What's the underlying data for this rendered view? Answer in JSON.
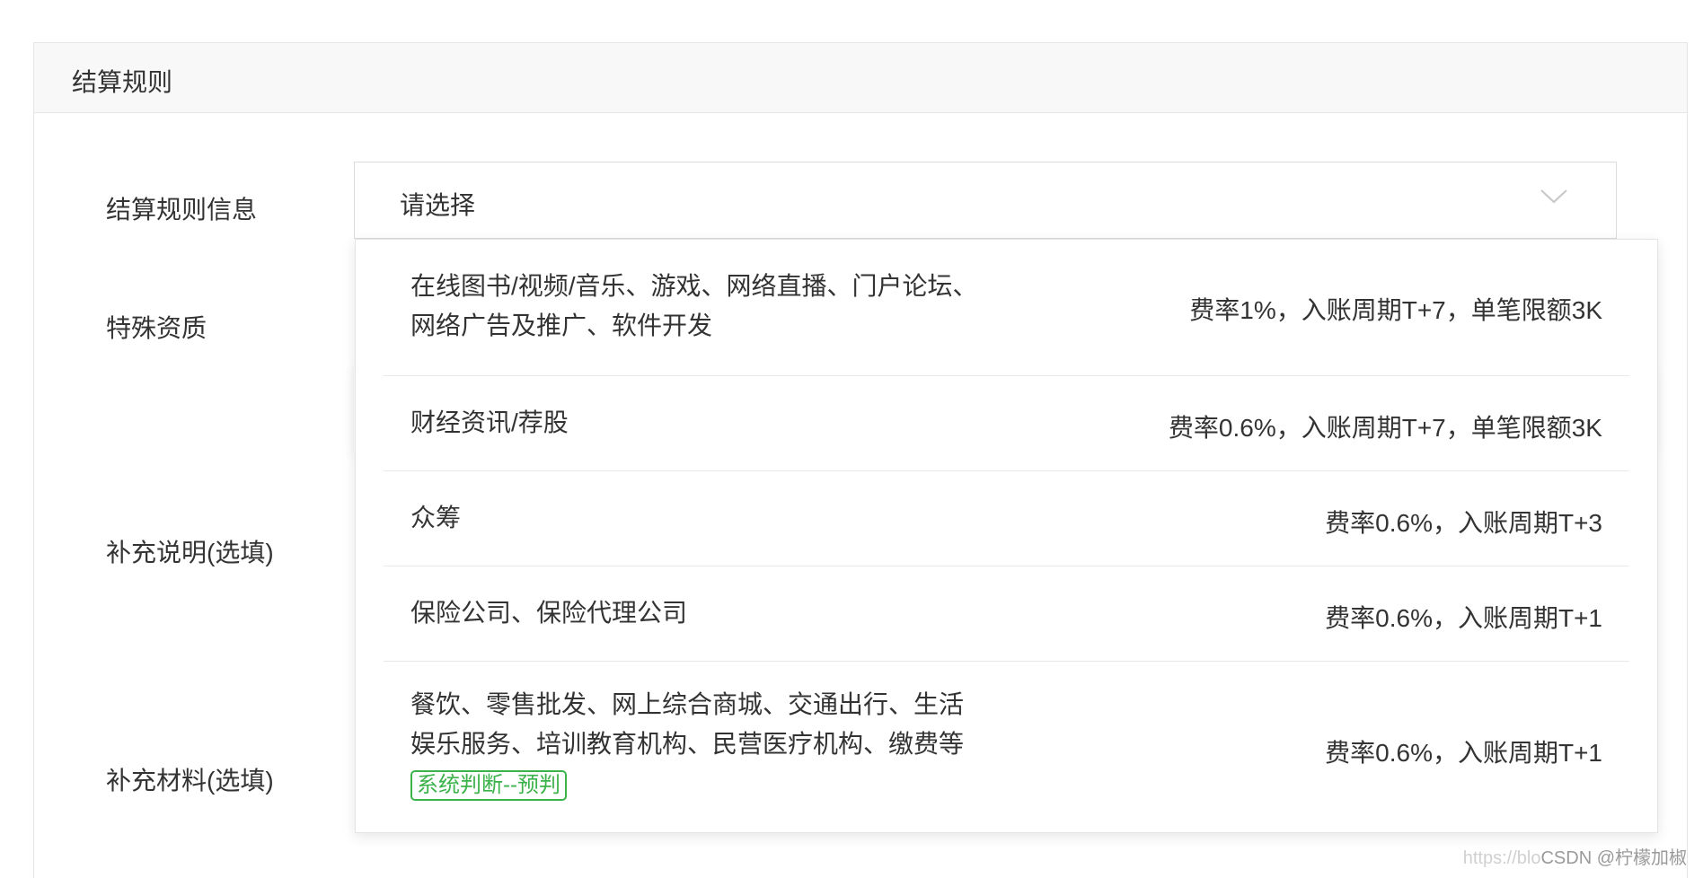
{
  "card": {
    "title": "结算规则"
  },
  "form": {
    "labels": {
      "settlement_rule_info": "结算规则信息",
      "special_qualification": "特殊资质",
      "supplement_note": "补充说明(选填)",
      "supplement_material": "补充材料(选填)"
    },
    "select": {
      "placeholder": "请选择",
      "icon": "chevron-down-icon"
    }
  },
  "dropdown": {
    "options": [
      {
        "name": "在线图书/视频/音乐、游戏、网络直播、门户论坛、网络广告及推广、软件开发",
        "rule": "费率1%，入账周期T+7，单笔限额3K"
      },
      {
        "name": "财经资讯/荐股",
        "rule": "费率0.6%，入账周期T+7，单笔限额3K"
      },
      {
        "name": "众筹",
        "rule": "费率0.6%，入账周期T+3"
      },
      {
        "name": "保险公司、保险代理公司",
        "rule": "费率0.6%，入账周期T+1"
      },
      {
        "name": "餐饮、零售批发、网上综合商城、交通出行、生活娱乐服务、培训教育机构、民营医疗机构、缴费等",
        "rule": "费率0.6%，入账周期T+1",
        "tag": "系统判断--预判"
      }
    ]
  },
  "watermark": {
    "faint": "https://blo",
    "text": "CSDN @柠檬加椒"
  },
  "colors": {
    "tag_green": "#3cb34a",
    "header_bg": "#f8f8f8",
    "border": "#e6e6e6"
  }
}
